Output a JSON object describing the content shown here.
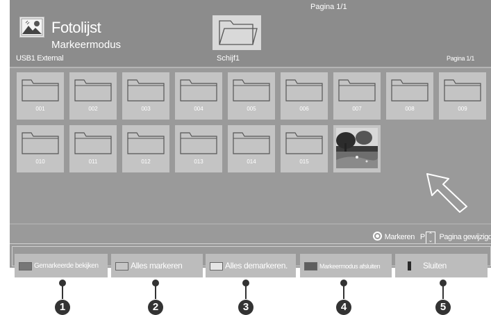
{
  "header": {
    "title": "Fotolijst",
    "subtitle": "Markeermodus",
    "device": "USB1 External",
    "drive": "Schijf1",
    "page_top": "Pagina 1/1",
    "page_right": "Pagina 1/1"
  },
  "folders": [
    "001",
    "002",
    "003",
    "004",
    "005",
    "006",
    "007",
    "008",
    "009",
    "010",
    "011",
    "012",
    "013",
    "014",
    "015"
  ],
  "legend": {
    "mark_label": "Markeren",
    "p_key": "P",
    "page_change_label": "Pagina gewijzigd"
  },
  "buttons": [
    {
      "label": "Gemarkeerde bekijken",
      "swatch": "#777777"
    },
    {
      "label": "Alles markeren",
      "swatch": "#c6c6c6"
    },
    {
      "label": "Alles demarkeren.",
      "swatch": "#e6e6e6"
    },
    {
      "label": "Markeermodus afsluiten",
      "swatch": "#5e5e5e"
    },
    {
      "label": "Sluiten",
      "swatch": "#2a2a2a"
    }
  ],
  "callouts": [
    "1",
    "2",
    "3",
    "4",
    "5"
  ],
  "colors": {
    "screen_bg": "#9a9a9a",
    "header_bg": "#8c8c8c",
    "tile_bg": "#c4c4c4",
    "callout": "#333333"
  }
}
